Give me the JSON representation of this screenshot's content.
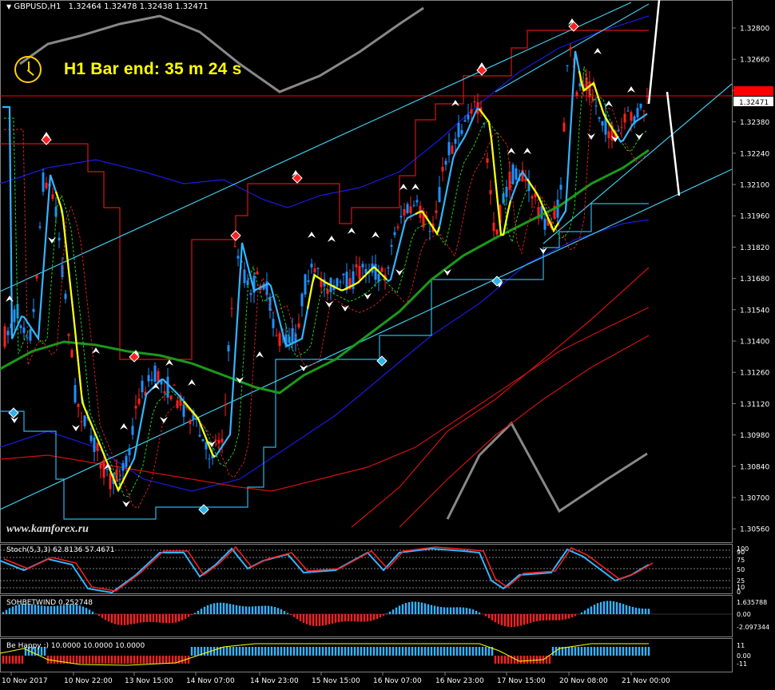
{
  "header": {
    "symbol": "GBPUSD,H1",
    "ohlc": "1.32464 1.32478 1.32438 1.32471"
  },
  "timer": {
    "text": "H1 Bar end: 35 m 24 s"
  },
  "watermark": "www.kamforex.ru",
  "price_axis": {
    "ticks": [
      "1.32800",
      "1.32660",
      "1.32520",
      "1.32380",
      "1.32240",
      "1.32100",
      "1.31960",
      "1.31820",
      "1.31680",
      "1.31540",
      "1.31400",
      "1.31260",
      "1.31120",
      "1.30980",
      "1.30840",
      "1.30700",
      "1.30560"
    ],
    "current_price": "1.32471",
    "current_price_color": "#ffffff",
    "red_line_color": "#ff0000"
  },
  "time_axis": {
    "labels": [
      "10 Nov 2017",
      "10 Nov 22:00",
      "13 Nov 15:00",
      "14 Nov 07:00",
      "14 Nov 23:00",
      "15 Nov 15:00",
      "16 Nov 07:00",
      "16 Nov 23:00",
      "17 Nov 15:00",
      "20 Nov 08:00",
      "21 Nov 00:00"
    ]
  },
  "stoch": {
    "label": "Stoch(5,3,3) 62.8136 57.4671",
    "ticks": [
      "100",
      "90",
      "75",
      "50",
      "25",
      "10",
      "0"
    ]
  },
  "sohbet": {
    "label": "SOHBETWIND 0.252748",
    "ticks": [
      "1.635788",
      "0.00",
      "-2.097344"
    ]
  },
  "happy": {
    "label": "Be Happy :) 10.0000 10.0000 10.0000",
    "ticks": [
      "11",
      "0.00",
      "-11"
    ]
  },
  "colors": {
    "bull": "#1e90ff",
    "bear": "#ff2020",
    "ma_green": "#1a9a1a",
    "channel": "#40c8e8",
    "yellow": "#ffff00",
    "cyan": "#33b5ff"
  }
}
